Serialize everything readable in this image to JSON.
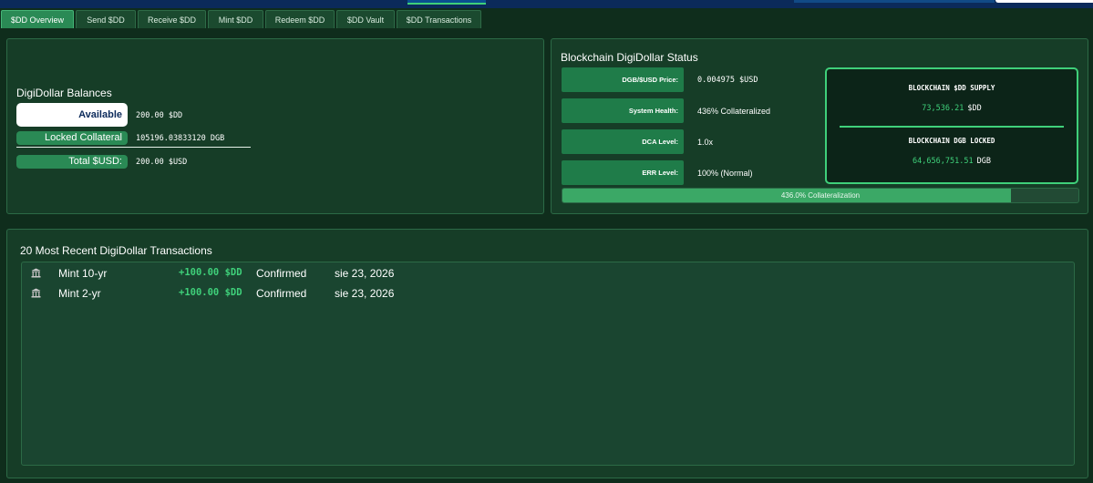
{
  "tabs": [
    {
      "label": "$DD Overview",
      "active": true
    },
    {
      "label": "Send $DD",
      "active": false
    },
    {
      "label": "Receive $DD",
      "active": false
    },
    {
      "label": "Mint $DD",
      "active": false
    },
    {
      "label": "Redeem $DD",
      "active": false
    },
    {
      "label": "$DD Vault",
      "active": false
    },
    {
      "label": "$DD Transactions",
      "active": false
    }
  ],
  "balances": {
    "title": "DigiDollar Balances",
    "available_label": "Available",
    "available_value": "200.00 $DD",
    "locked_label": "Locked Collateral",
    "locked_value": "105196.03833120 DGB",
    "total_label": "Total $USD:",
    "total_value": "200.00 $USD"
  },
  "status": {
    "title": "Blockchain DigiDollar Status",
    "price_label": "DGB/$USD Price:",
    "price_value": "0.004975 $USD",
    "health_label": "System Health:",
    "health_value": "436% Collateralized",
    "dca_label": "DCA Level:",
    "dca_value": "1.0x",
    "err_label": "ERR Level:",
    "err_value": "100% (Normal)",
    "supply_title": "BLOCKCHAIN $DD SUPPLY",
    "supply_value": "73,536.21",
    "supply_unit": "$DD",
    "locked_title": "BLOCKCHAIN DGB LOCKED",
    "locked_value": "64,656,751.51",
    "locked_unit": "DGB",
    "collateral_progress": 0.869,
    "collateral_text": "436.0% Collateralization"
  },
  "transactions": {
    "title": "20 Most Recent DigiDollar Transactions",
    "items": [
      {
        "icon": "bank-icon",
        "label": "Mint 10-yr",
        "amount": "+100.00 $DD",
        "status": "Confirmed",
        "date": "sie 23, 2026"
      },
      {
        "icon": "bank-icon",
        "label": "Mint 2-yr",
        "amount": "+100.00 $DD",
        "status": "Confirmed",
        "date": "sie 23, 2026"
      }
    ]
  },
  "colors": {
    "accent": "#3fd07a",
    "panel": "#163d27",
    "background": "#0f2d1c"
  }
}
